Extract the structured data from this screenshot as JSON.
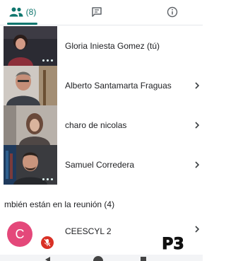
{
  "tabs": {
    "people_count": "(8)",
    "active": "people",
    "accent_color": "#0f766e"
  },
  "participants": [
    {
      "name": "Gloria Iniesta Gomez (tú)",
      "speaking": true,
      "has_chevron": false
    },
    {
      "name": "Alberto Santamarta Fraguas",
      "speaking": false,
      "has_chevron": true
    },
    {
      "name": "charo de nicolas",
      "speaking": false,
      "has_chevron": true
    },
    {
      "name": "Samuel Corredera",
      "speaking": true,
      "has_chevron": true
    }
  ],
  "also_in_meeting": {
    "header": "mbién están en la reunión (4)",
    "items": [
      {
        "initial": "C",
        "name": "CEESCYL 2",
        "muted": true,
        "avatar_color": "#e4487a"
      }
    ]
  },
  "watermark": {
    "text": "P3"
  }
}
